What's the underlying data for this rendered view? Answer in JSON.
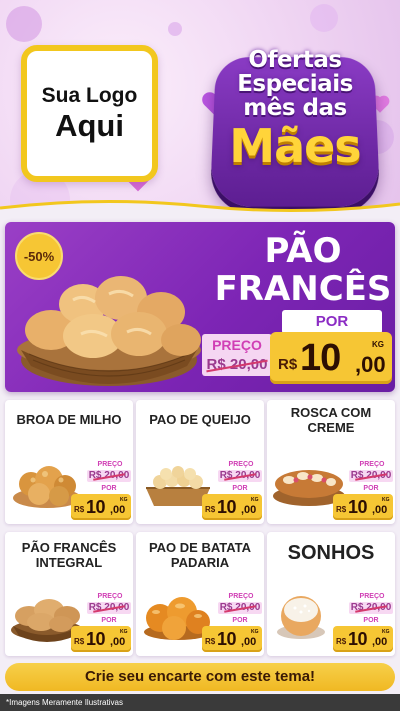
{
  "header": {
    "logo_line1": "Sua Logo",
    "logo_line2": "Aqui",
    "title_line1": "Ofertas",
    "title_line2": "Especiais",
    "title_line3": "mês das",
    "title_line4": "Mães"
  },
  "featured": {
    "discount": "-50%",
    "name_line1": "PÃO",
    "name_line2": "FRANCÊS",
    "preco_label": "PREÇO",
    "old_price": "R$ 20,00",
    "por_label": "POR",
    "currency": "R$",
    "price_int": "10",
    "price_cents": ",00",
    "unit": "KG"
  },
  "products": [
    {
      "name": "BROA DE MILHO",
      "image": "corn-bread-icon",
      "preco_label": "PREÇO",
      "old_price": "R$ 20,00",
      "por_label": "POR",
      "currency": "R$",
      "price_int": "10",
      "price_cents": ",00",
      "unit": "KG"
    },
    {
      "name": "PAO DE QUEIJO",
      "image": "cheese-bread-icon",
      "preco_label": "PREÇO",
      "old_price": "R$ 20,00",
      "por_label": "POR",
      "currency": "R$",
      "price_int": "10",
      "price_cents": ",00",
      "unit": "KG"
    },
    {
      "name": "ROSCA COM CREME",
      "image": "braided-bread-icon",
      "preco_label": "PREÇO",
      "old_price": "R$ 20,00",
      "por_label": "POR",
      "currency": "R$",
      "price_int": "10",
      "price_cents": ",00",
      "unit": "KG"
    },
    {
      "name": "PÃO FRANCÊS INTEGRAL",
      "image": "whole-bread-icon",
      "preco_label": "PREÇO",
      "old_price": "R$ 20,00",
      "por_label": "POR",
      "currency": "R$",
      "price_int": "10",
      "price_cents": ",00",
      "unit": "KG"
    },
    {
      "name": "PAO DE BATATA PADARIA",
      "image": "potato-bread-icon",
      "preco_label": "PREÇO",
      "old_price": "R$ 20,00",
      "por_label": "POR",
      "currency": "R$",
      "price_int": "10",
      "price_cents": ",00",
      "unit": "KG"
    },
    {
      "name": "SONHOS",
      "image": "donut-icon",
      "preco_label": "PREÇO",
      "old_price": "R$ 20,00",
      "por_label": "POR",
      "currency": "R$",
      "price_int": "10",
      "price_cents": ",00",
      "unit": "KG"
    }
  ],
  "cta": {
    "label": "Crie seu encarte com este tema!"
  },
  "footer": {
    "disclaimer": "*Imagens Meramente Ilustrativas"
  },
  "colors": {
    "purple": "#8b2cc4",
    "yellow": "#f6c634",
    "pink": "#d03fb5"
  }
}
